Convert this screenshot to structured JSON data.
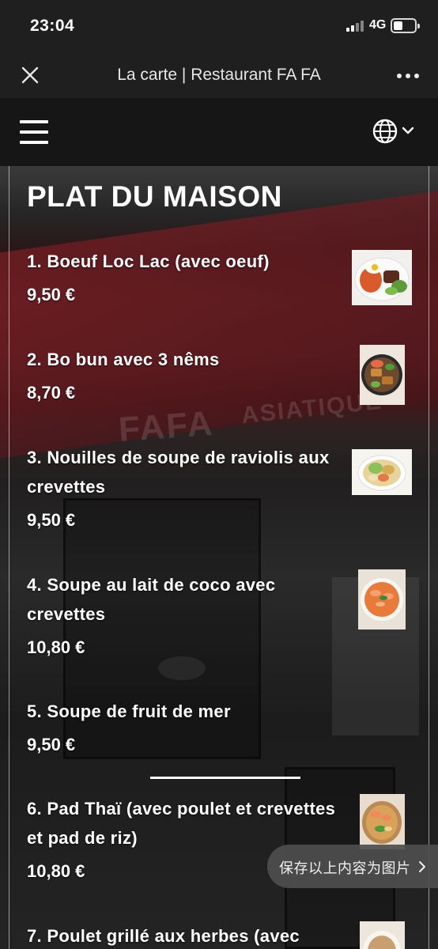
{
  "status_bar": {
    "time": "23:04",
    "network": "4G"
  },
  "title_bar": {
    "title": "La carte | Restaurant FA FA"
  },
  "menu": {
    "section_title": "PLAT DU MAISON",
    "dishes": [
      {
        "name": "1. Boeuf Loc Lac (avec oeuf)",
        "price": "9,50 €",
        "image_icon": "rice-egg-plate"
      },
      {
        "name": "2. Bo bun avec 3 nêms",
        "price": "8,70 €",
        "image_icon": "bo-bun-bowl"
      },
      {
        "name": "3. Nouilles de soupe de raviolis aux crevettes",
        "price": "9,50 €",
        "image_icon": "noodle-soup-bowl"
      },
      {
        "name": "4. Soupe au lait de coco avec crevettes",
        "price": "10,80 €",
        "image_icon": "coconut-soup-bowl"
      },
      {
        "name": "5. Soupe de fruit de mer",
        "price": "9,50 €"
      },
      {
        "name": "6. Pad Thaï (avec poulet et crevettes et pad de riz)",
        "price": "10,80 €",
        "image_icon": "pad-thai-plate"
      },
      {
        "name": "7. Poulet grillé aux herbes (avec",
        "image_icon": "grilled-chicken-dish"
      }
    ]
  },
  "save_image_prompt": {
    "label": "保存以上内容为图片"
  },
  "background_sign": {
    "brand": "FAFA",
    "subtitle": "ASIATIQUE"
  },
  "colors": {
    "status_bar_bg": "#1f1f1f",
    "header_bg": "#161616",
    "text": "#ffffff",
    "awning_red": "#5b2024"
  }
}
